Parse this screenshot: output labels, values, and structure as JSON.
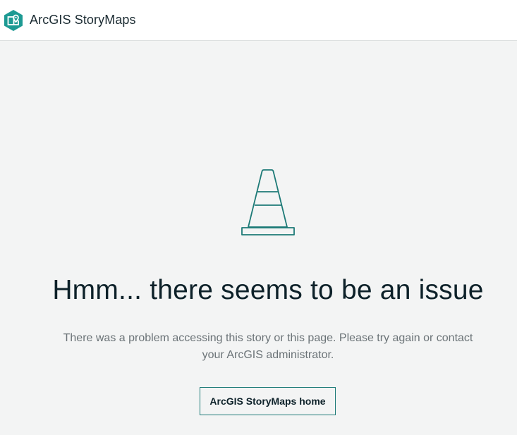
{
  "header": {
    "brand_name": "ArcGIS StoryMaps",
    "logo_icon": "storymaps-logo-icon"
  },
  "error": {
    "illustration_icon": "traffic-cone-icon",
    "headline": "Hmm... there seems to be an issue",
    "message": "There was a problem accessing this story or this page. Please try again or contact your ArcGIS administrator.",
    "home_button_label": "ArcGIS StoryMaps home"
  },
  "colors": {
    "brand_teal": "#1d9a93",
    "accent_teal": "#1d7a77",
    "background": "#f3f4f4",
    "header_bg": "#ffffff"
  }
}
